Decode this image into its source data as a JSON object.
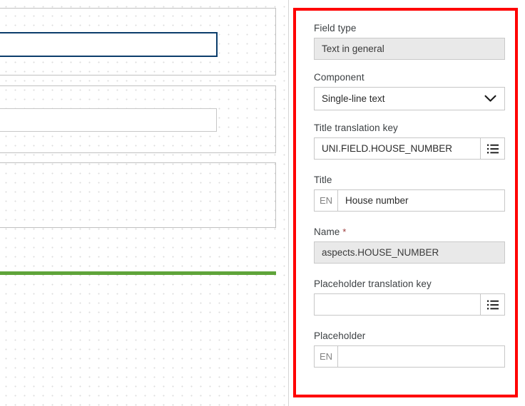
{
  "canvas": {
    "name": "form-designer-canvas",
    "cards": [
      {
        "id": "card-1",
        "label": "form-row-card"
      },
      {
        "id": "card-2",
        "label": "form-row-card"
      },
      {
        "id": "card-3",
        "label": "form-row-card"
      }
    ],
    "selected_field_border_color": "#0b3d6b",
    "drop_indicator_color": "#5fa43a"
  },
  "properties_panel": {
    "highlight_color": "#ff0000",
    "groups": [
      {
        "label": "Field type",
        "type": "disabled-input",
        "value": "Text in general"
      },
      {
        "label": "Component",
        "type": "select",
        "value": "Single-line text",
        "icon": "chevron-down-icon"
      },
      {
        "label": "Title translation key",
        "type": "input-with-button",
        "value": "UNI.FIELD.HOUSE_NUMBER",
        "placeholder": "",
        "icon": "list-picker-icon"
      },
      {
        "label": "Title",
        "type": "locale-input",
        "locale": "EN",
        "value": "House number",
        "placeholder": ""
      },
      {
        "label": "Name",
        "required_marker": "*",
        "type": "disabled-input",
        "value": "aspects.HOUSE_NUMBER"
      },
      {
        "label": "Placeholder translation key",
        "type": "input-with-button",
        "value": "",
        "placeholder": "",
        "icon": "list-picker-icon"
      },
      {
        "label": "Placeholder",
        "type": "locale-input",
        "locale": "EN",
        "value": "",
        "placeholder": ""
      }
    ]
  }
}
